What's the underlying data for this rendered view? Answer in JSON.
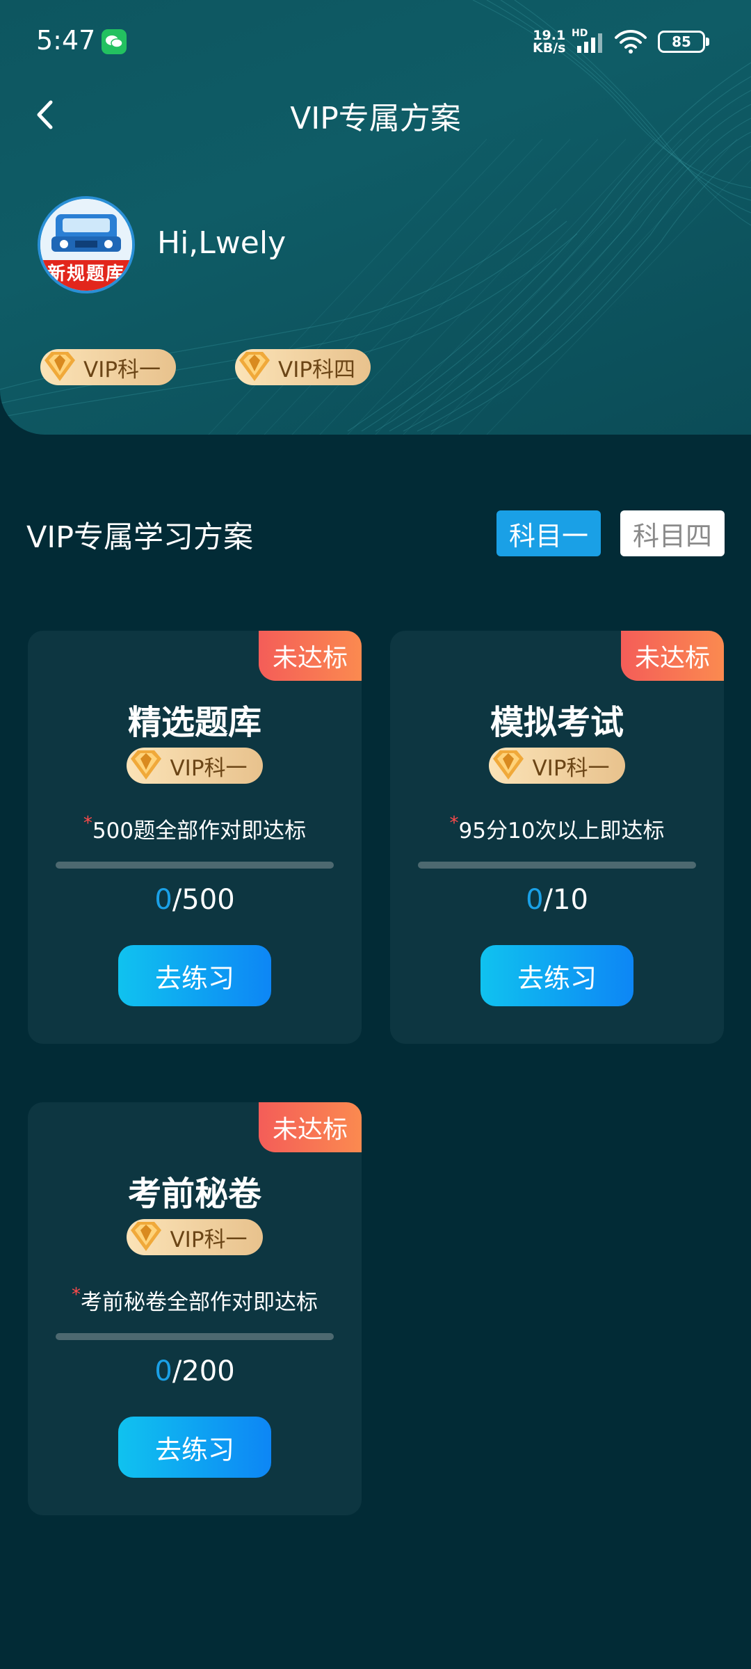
{
  "status_bar": {
    "time": "5:47",
    "net_speed_value": "19.1",
    "net_speed_unit": "KB/s",
    "network_type": "HD",
    "battery": "85",
    "icons": [
      "wechat-icon",
      "signal-icon",
      "wifi-icon",
      "battery-icon"
    ]
  },
  "header": {
    "title": "VIP专属方案",
    "back_icon": "chevron-left-icon"
  },
  "profile": {
    "greeting": "Hi,Lwely",
    "avatar_banner": "新规题库",
    "vip_badges": [
      "VIP科一",
      "VIP科四"
    ]
  },
  "plan": {
    "title": "VIP专属学习方案",
    "tabs": [
      {
        "label": "科目一",
        "active": true
      },
      {
        "label": "科目四",
        "active": false
      }
    ]
  },
  "cards": [
    {
      "status": "未达标",
      "title": "精选题库",
      "badge": "VIP科一",
      "requirement_star": "*",
      "requirement": "500题全部作对即达标",
      "done": "0",
      "total": "/500",
      "progress": 0,
      "button": "去练习"
    },
    {
      "status": "未达标",
      "title": "模拟考试",
      "badge": "VIP科一",
      "requirement_star": "*",
      "requirement": "95分10次以上即达标",
      "done": "0",
      "total": "/10",
      "progress": 0,
      "button": "去练习"
    },
    {
      "status": "未达标",
      "title": "考前秘卷",
      "badge": "VIP科一",
      "requirement_star": "*",
      "requirement": "考前秘卷全部作对即达标",
      "done": "0",
      "total": "/200",
      "progress": 0,
      "button": "去练习"
    }
  ],
  "colors": {
    "background": "#022b36",
    "header": "#0f5c66",
    "card": "#0d3641",
    "accent": "#1aa0e6",
    "status_badge": "#f45d58",
    "vip_gold": "#e8c28d"
  }
}
